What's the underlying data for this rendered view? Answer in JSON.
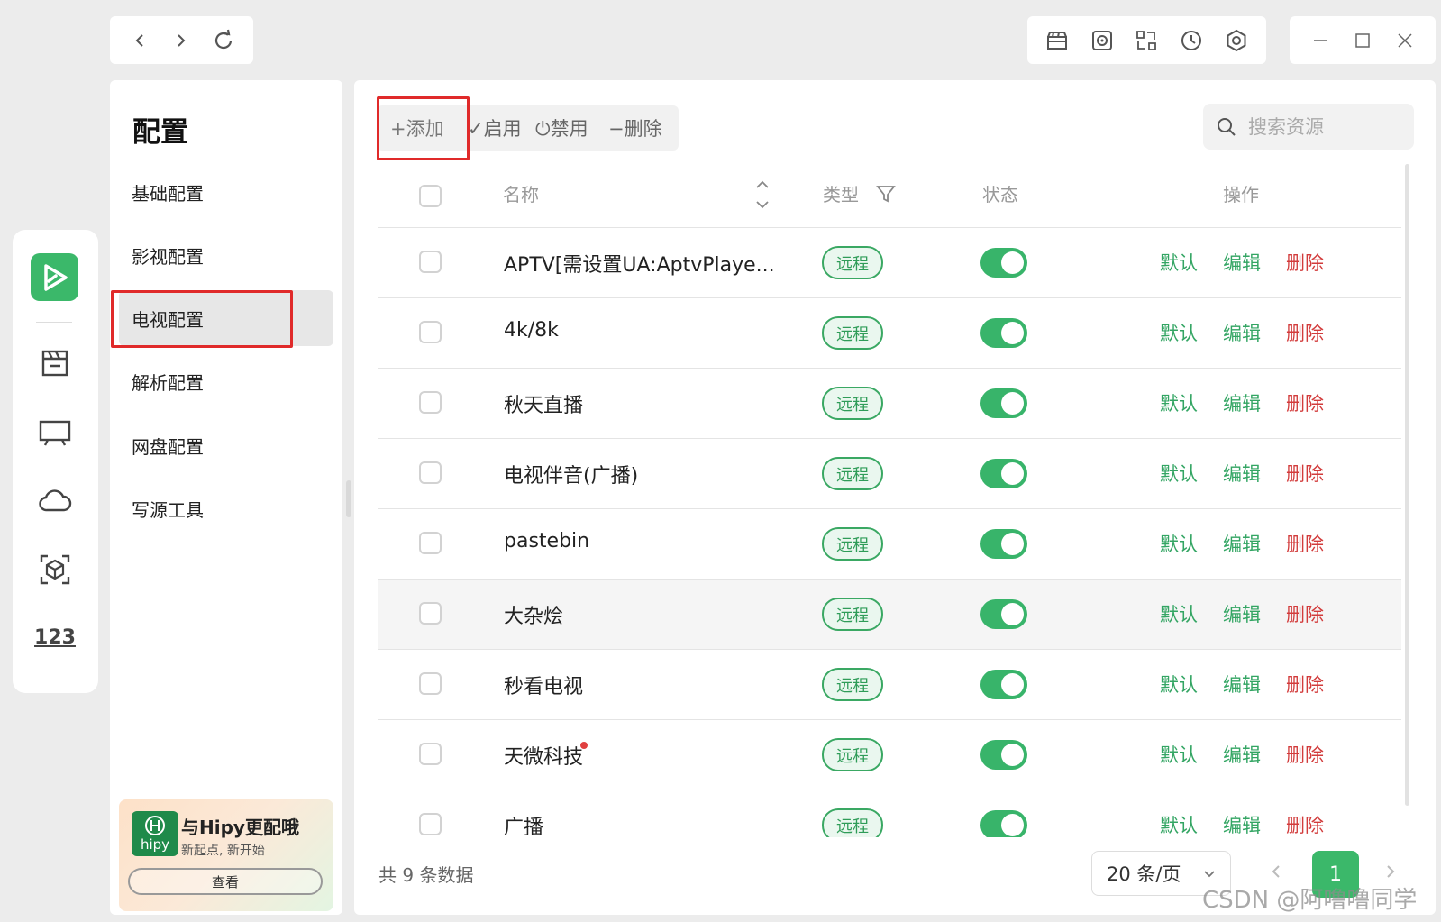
{
  "sidebar": {
    "title": "配置",
    "items": [
      {
        "label": "基础配置"
      },
      {
        "label": "影视配置"
      },
      {
        "label": "电视配置"
      },
      {
        "label": "解析配置"
      },
      {
        "label": "网盘配置"
      },
      {
        "label": "写源工具"
      }
    ],
    "active_index": 2
  },
  "promo": {
    "logo_text": "hipy",
    "title": "与Hipy更配哦",
    "subtitle": "新起点, 新开始",
    "button": "查看"
  },
  "toolbar": {
    "add": "+添加",
    "enable": "✓启用",
    "disable": "⏻禁用",
    "delete": "−删除"
  },
  "search": {
    "placeholder": "搜索资源"
  },
  "table": {
    "headers": {
      "name": "名称",
      "type": "类型",
      "status": "状态",
      "actions": "操作"
    },
    "rows": [
      {
        "name": "APTV[需设置UA:AptvPlaye...",
        "type": "远程",
        "enabled": true
      },
      {
        "name": "4k/8k",
        "type": "远程",
        "enabled": true
      },
      {
        "name": "秋天直播",
        "type": "远程",
        "enabled": true
      },
      {
        "name": "电视伴音(广播)",
        "type": "远程",
        "enabled": true
      },
      {
        "name": "pastebin",
        "type": "远程",
        "enabled": true
      },
      {
        "name": "大杂烩",
        "type": "远程",
        "enabled": true
      },
      {
        "name": "秒看电视",
        "type": "远程",
        "enabled": true
      },
      {
        "name": "天微科技",
        "type": "远程",
        "enabled": true
      },
      {
        "name": "广播",
        "type": "远程",
        "enabled": true
      }
    ],
    "actions": {
      "default": "默认",
      "edit": "编辑",
      "delete": "删除"
    }
  },
  "footer": {
    "total": "共 9 条数据",
    "page_size": "20 条/页",
    "current_page": "1"
  },
  "watermark": "CSDN @阿噜噜同学",
  "colors": {
    "accent": "#3bb86a",
    "danger": "#d23b3b",
    "highlight_box": "#e02a2a"
  },
  "icons": {
    "top_tools": [
      "film-clapper-icon",
      "disc-icon",
      "translate-icon",
      "history-icon",
      "settings-hex-icon"
    ],
    "rail": [
      "app-logo-icon",
      "film-box-icon",
      "tv-icon",
      "cloud-icon",
      "cube-scan-icon",
      "numbers-123-icon"
    ]
  }
}
